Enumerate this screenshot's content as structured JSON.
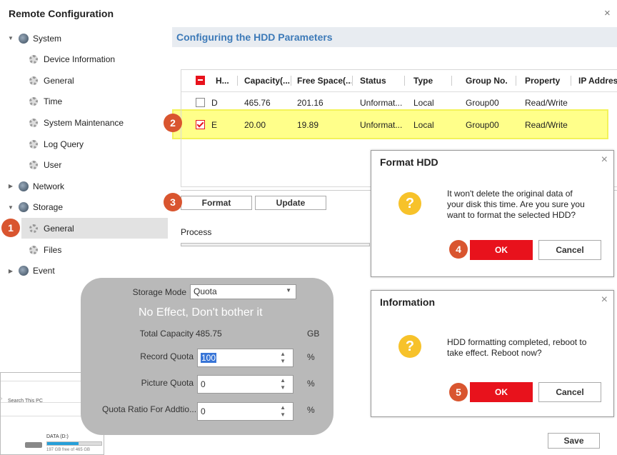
{
  "window": {
    "title": "Remote Configuration"
  },
  "tree": [
    {
      "label": "System",
      "level": 0,
      "expand": "down"
    },
    {
      "label": "Device Information",
      "level": 1
    },
    {
      "label": "General",
      "level": 1
    },
    {
      "label": "Time",
      "level": 1
    },
    {
      "label": "System Maintenance",
      "level": 1
    },
    {
      "label": "Log Query",
      "level": 1
    },
    {
      "label": "User",
      "level": 1
    },
    {
      "label": "Network",
      "level": 0,
      "expand": "right"
    },
    {
      "label": "Storage",
      "level": 0,
      "expand": "down"
    },
    {
      "label": "General",
      "level": 1,
      "selected": true
    },
    {
      "label": "Files",
      "level": 1
    },
    {
      "label": "Event",
      "level": 0,
      "expand": "right"
    }
  ],
  "panel": {
    "title": "Configuring the HDD Parameters",
    "columns": [
      "H...",
      "Capacity(...",
      "Free Space(...",
      "Status",
      "Type",
      "Group No.",
      "Property",
      "IP Address"
    ],
    "rows": [
      {
        "hdd": "D",
        "capacity": "465.76",
        "free": "201.16",
        "status": "Unformat...",
        "type": "Local",
        "group": "Group00",
        "property": "Read/Write"
      },
      {
        "hdd": "E",
        "capacity": "20.00",
        "free": "19.89",
        "status": "Unformat...",
        "type": "Local",
        "group": "Group00",
        "property": "Read/Write"
      }
    ],
    "format_label": "Format",
    "update_label": "Update",
    "process_label": "Process",
    "save_label": "Save"
  },
  "badges": [
    "1",
    "2",
    "3",
    "4",
    "5"
  ],
  "format_dialog": {
    "title": "Format HDD",
    "message_lines": [
      "It won't delete the original data of",
      "your disk this time. Are you sure you",
      "want to format the selected HDD?"
    ],
    "ok": "OK",
    "cancel": "Cancel"
  },
  "info_dialog": {
    "title": "Information",
    "message_lines": [
      "HDD formatting completed, reboot to",
      "take effect. Reboot now?"
    ],
    "ok": "OK",
    "cancel": "Cancel"
  },
  "storage_overlay": {
    "mode_label": "Storage Mode",
    "mode_value": "Quota",
    "note": "No Effect, Don't bother it",
    "total_label": "Total Capacity",
    "total_value": "485.75",
    "total_unit": "GB",
    "record_label": "Record Quota",
    "record_value": "100",
    "picture_label": "Picture Quota",
    "picture_value": "0",
    "ratio_label": "Quota Ratio For Addtio...",
    "ratio_value": "0",
    "percent": "%"
  },
  "explorer": {
    "search_placeholder": "Search This PC",
    "drive_label": "DATA (D:)",
    "drive_info": "197 GB free of 465 GB",
    "drive_fill": 0.58
  },
  "colors": {
    "accent": "#3d7ab8",
    "ok": "#e8121c",
    "badge": "#d9552f",
    "highlight": "#ffff8a",
    "warning": "#f7c22a"
  }
}
